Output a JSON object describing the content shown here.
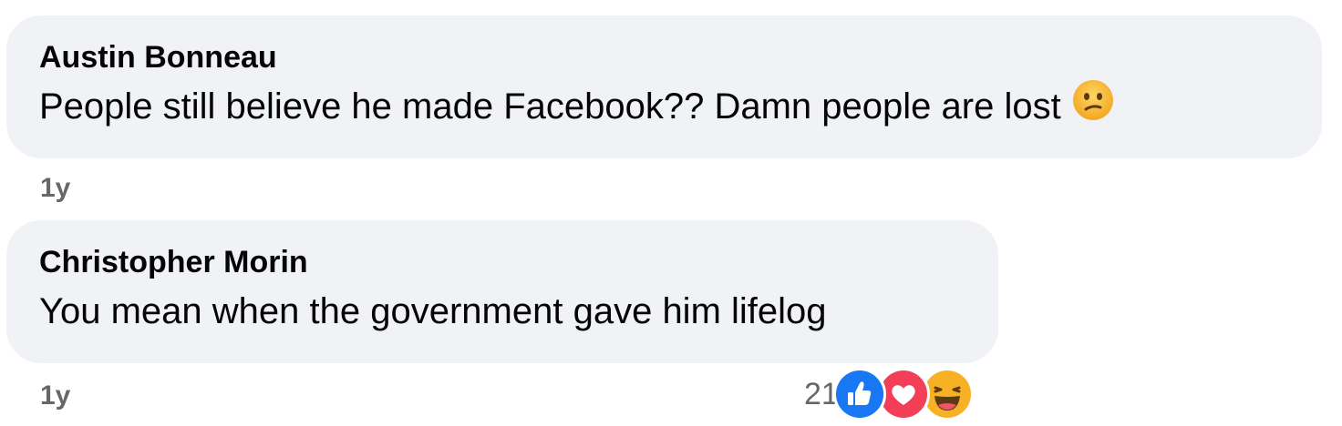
{
  "comments": [
    {
      "author": "Austin Bonneau",
      "text": "People still believe he made Facebook?? Damn people are lost",
      "emoji_icon": "confused-face-icon",
      "time": "1y"
    },
    {
      "author": "Christopher Morin",
      "text": "You mean when the government gave him lifelog",
      "time": "1y",
      "reactions": {
        "count": "21",
        "icons": [
          "like-reaction-icon",
          "love-reaction-icon",
          "haha-reaction-icon"
        ]
      }
    }
  ],
  "colors": {
    "bubble": "#f0f2f5",
    "meta_text": "#65676b",
    "like_blue": "#1877f2",
    "love_red": "#f33e58",
    "haha_yellow": "#f7b125"
  }
}
